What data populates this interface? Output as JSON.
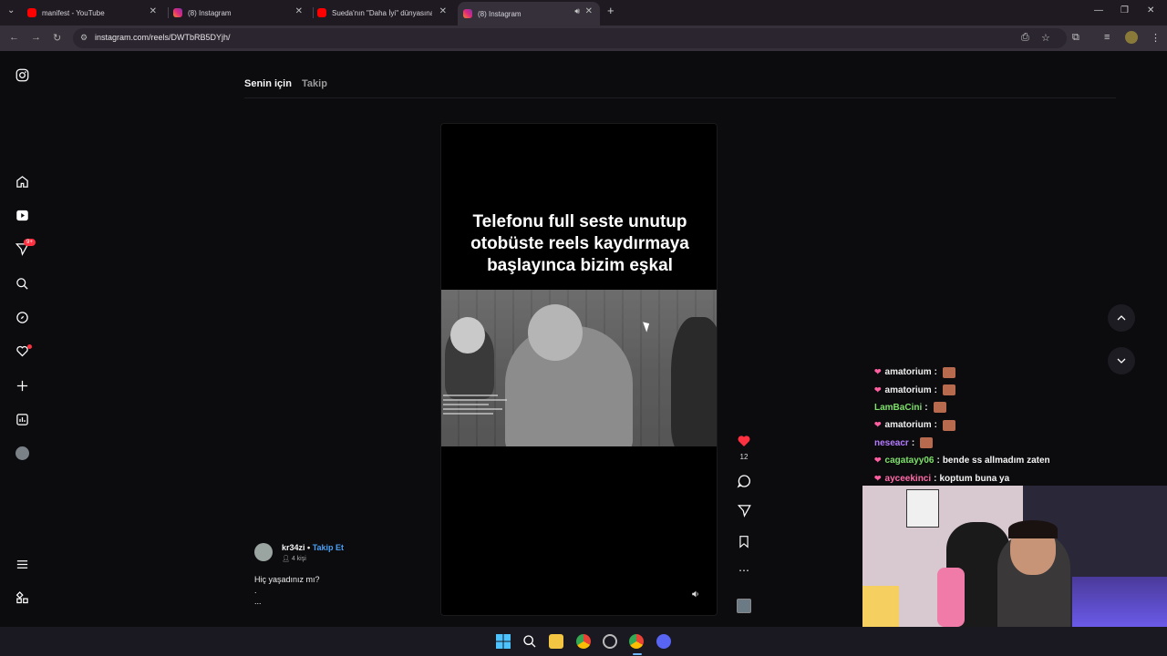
{
  "browser": {
    "tabs": [
      {
        "title": "manifest - YouTube"
      },
      {
        "title": "(8) Instagram"
      },
      {
        "title": "Sueda'nın \"Daha İyi\" dünyasına"
      },
      {
        "title": "(8) Instagram"
      }
    ],
    "url": "instagram.com/reels/DWTbRB5DYjh/"
  },
  "instagram": {
    "sidebar_badge": "9+",
    "feed_tabs": {
      "for_you": "Senin için",
      "following": "Takip"
    },
    "reel": {
      "overlay_text_line1": "Telefonu full seste unutup",
      "overlay_text_line2": "otobüste reels kaydırmaya",
      "overlay_text_line3": "başlayınca bizim eşkal",
      "likes": "12"
    },
    "author": {
      "username": "kr34zi",
      "separator": "•",
      "follow_label": "Takip Et",
      "audience": "4 kişi"
    },
    "description": {
      "line1": "Hiç yaşadınız mı?",
      "line2": ".",
      "line3": "..."
    }
  },
  "stream_chat": [
    {
      "user": "amatorium",
      "text": "",
      "color": "#f0f0f0",
      "heart": true,
      "emote": true
    },
    {
      "user": "amatorium",
      "text": "",
      "color": "#f0f0f0",
      "heart": true,
      "emote": true
    },
    {
      "user": "LamBaCini",
      "text": "",
      "color": "#7ee06a",
      "heart": false,
      "emote": true
    },
    {
      "user": "amatorium",
      "text": "",
      "color": "#f0f0f0",
      "heart": true,
      "emote": true
    },
    {
      "user": "neseacr",
      "text": "",
      "color": "#b57bff",
      "heart": false,
      "emote": true
    },
    {
      "user": "cagatayy06",
      "text": "bende ss allmadım zaten",
      "color": "#7ee06a",
      "heart": true,
      "emote": false
    },
    {
      "user": "ayceekinci",
      "text": "koptum buna ya",
      "color": "#ff6ba8",
      "heart": true,
      "emote": false
    }
  ],
  "chat_separator": ":"
}
